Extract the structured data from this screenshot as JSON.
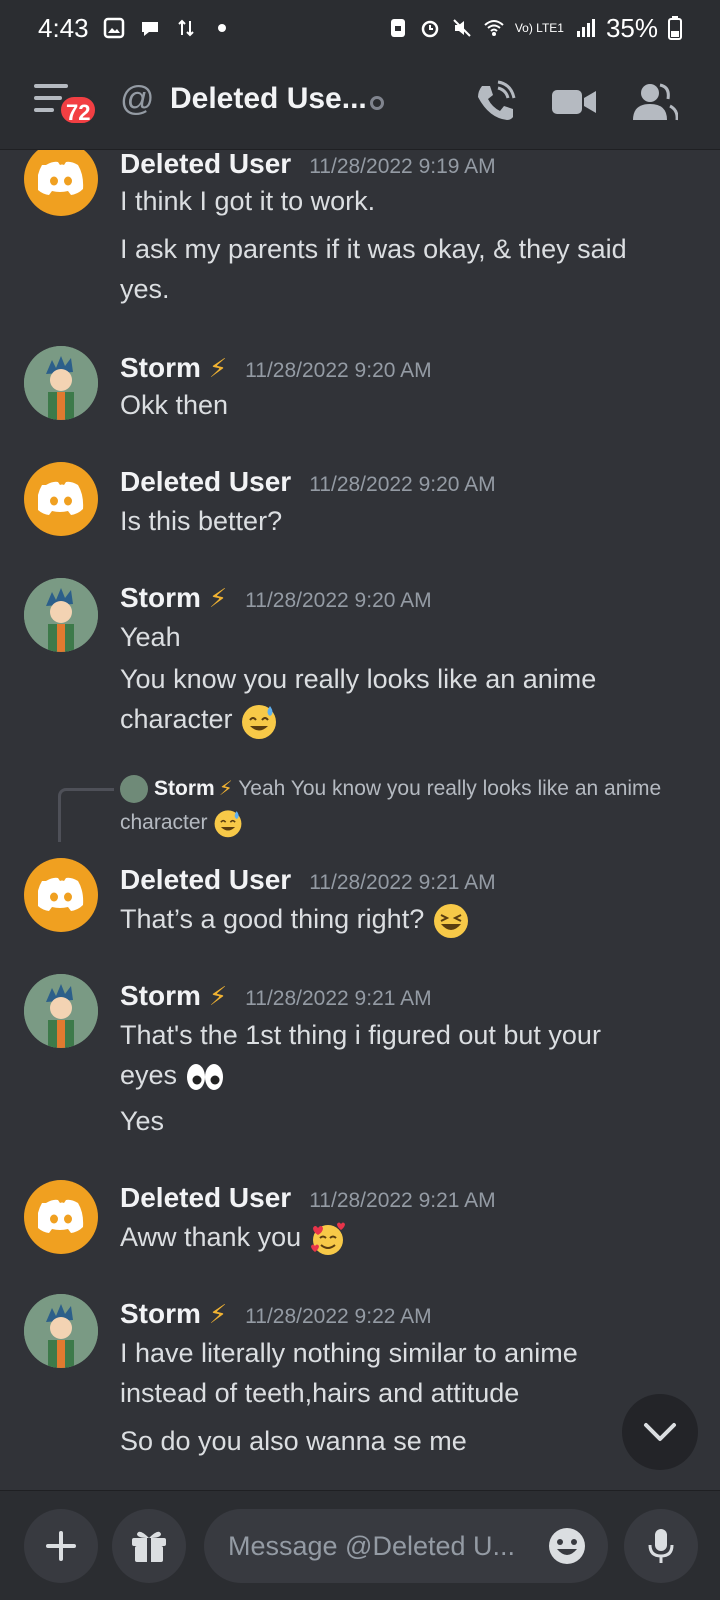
{
  "status_bar": {
    "time": "4:43",
    "network_label": "Vo) LTE1",
    "battery": "35%"
  },
  "header": {
    "unread_badge": "72",
    "channel_title": "Deleted Use..."
  },
  "messages": [
    {
      "author": "Deleted User",
      "time": "11/28/2022 9:19 AM",
      "lines": [
        "I think I got it to work.",
        "I ask my parents if it was okay, & they said",
        "yes."
      ]
    },
    {
      "author": "Storm",
      "time": "11/28/2022 9:20 AM",
      "lines": [
        "Okk then"
      ]
    },
    {
      "author": "Deleted User",
      "time": "11/28/2022 9:20 AM",
      "lines": [
        "Is this better?"
      ]
    },
    {
      "author": "Storm",
      "time": "11/28/2022 9:20 AM",
      "lines": [
        "Yeah",
        "You know you really looks like an anime",
        "character"
      ]
    },
    {
      "author": "Deleted User",
      "time": "11/28/2022 9:21 AM",
      "lines": [
        "That’s a good thing right?"
      ]
    },
    {
      "author": "Storm",
      "time": "11/28/2022 9:21 AM",
      "lines": [
        "That's the 1st thing i figured out but your",
        "eyes",
        "Yes"
      ]
    },
    {
      "author": "Deleted User",
      "time": "11/28/2022 9:21 AM",
      "lines": [
        "Aww thank you"
      ]
    },
    {
      "author": "Storm",
      "time": "11/28/2022 9:22 AM",
      "lines": [
        "I have literally nothing similar to anime",
        "instead of teeth,hairs and attitude",
        "So do you also wanna se me"
      ]
    }
  ],
  "reply_preview": {
    "author": "Storm",
    "text_line1": "Yeah You know you really looks like an anime",
    "text_line2": "character"
  },
  "composer": {
    "placeholder": "Message @Deleted U..."
  },
  "colors": {
    "background": "#313338",
    "header": "#2b2d31",
    "discord_avatar": "#f0a020",
    "badge": "#f23f43"
  }
}
